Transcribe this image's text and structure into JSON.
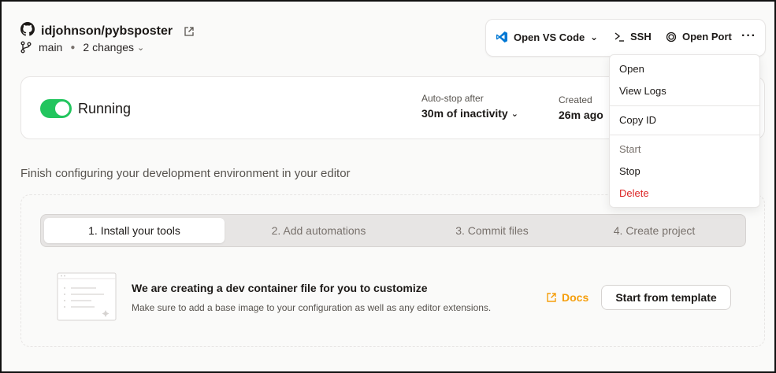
{
  "header": {
    "repo_name": "idjohnson/pybsposter",
    "branch": "main",
    "changes": "2 changes"
  },
  "toolbar": {
    "open_vscode": "Open VS Code",
    "ssh": "SSH",
    "open_port": "Open Port"
  },
  "status": {
    "label": "Running",
    "running": true,
    "autostop_label": "Auto-stop after",
    "autostop_value": "30m of inactivity",
    "created_label": "Created",
    "created_value": "26m ago"
  },
  "setup": {
    "title": "Finish configuring your development environment in your editor",
    "steps": [
      {
        "label": "1. Install your tools",
        "active": true
      },
      {
        "label": "2. Add automations",
        "active": false
      },
      {
        "label": "3. Commit files",
        "active": false
      },
      {
        "label": "4. Create project",
        "active": false
      }
    ],
    "info_title": "We are creating a dev container file for you to customize",
    "info_sub": "Make sure to add a base image to your configuration as well as any editor extensions.",
    "docs_label": "Docs",
    "template_button": "Start from template"
  },
  "menu": {
    "open": "Open",
    "view_logs": "View Logs",
    "copy_id": "Copy ID",
    "start": "Start",
    "stop": "Stop",
    "delete": "Delete"
  },
  "colors": {
    "running_green": "#22c55e",
    "docs_orange": "#f59e0b",
    "delete_red": "#dc2626",
    "vscode_blue": "#0078d4"
  },
  "icons": [
    "github-icon",
    "external-link-icon",
    "git-branch-icon",
    "chevron-down-icon",
    "vscode-icon",
    "terminal-icon",
    "port-icon",
    "more-icon",
    "file-illustration-icon"
  ]
}
